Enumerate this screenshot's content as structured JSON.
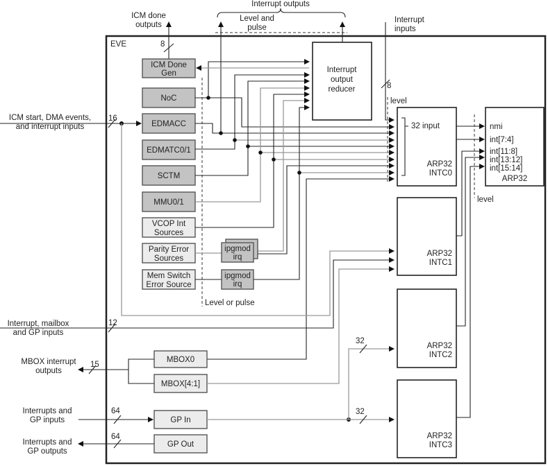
{
  "frame_label": "EVE",
  "blocks": {
    "icm_done_gen": [
      "ICM Done",
      "Gen"
    ],
    "noc": "NoC",
    "edmacc": "EDMACC",
    "edmatc": "EDMATC0/1",
    "sctm": "SCTM",
    "mmu": "MMU0/1",
    "vcop": [
      "VCOP Int",
      "Sources"
    ],
    "parity": [
      "Parity Error",
      "Sources"
    ],
    "memswitch": [
      "Mem Switch",
      "Error Source"
    ],
    "ipgmod1": [
      "ipgmod",
      "irq"
    ],
    "ipgmod2": [
      "ipgmod",
      "irq"
    ],
    "reducer": [
      "Interrupt",
      "output",
      "reducer"
    ],
    "intc0": [
      "ARP32",
      "INTC0"
    ],
    "intc0_input_label": "32 input",
    "intc1": [
      "ARP32",
      "INTC1"
    ],
    "intc2": [
      "ARP32",
      "INTC2"
    ],
    "intc3": [
      "ARP32",
      "INTC3"
    ],
    "arp32": "ARP32",
    "arp32_ports": [
      "nmi",
      "int[7:4]",
      "int[11:8]",
      "int[13:12]",
      "int[15:14]"
    ],
    "mbox0": "MBOX0",
    "mbox41": "MBOX[4:1]",
    "gp_in": "GP In",
    "gp_out": "GP Out"
  },
  "signals": {
    "icm_done_outputs": [
      "ICM done",
      "outputs"
    ],
    "interrupt_outputs": "Interrupt outputs",
    "level_and_pulse": [
      "Level and",
      "pulse"
    ],
    "interrupt_inputs": [
      "Interrupt",
      "inputs"
    ],
    "icm_start": [
      "ICM start, DMA events,",
      "and interrupt inputs"
    ],
    "int_mailbox_gp": [
      "Interrupt, mailbox",
      "and GP inputs"
    ],
    "mbox_outputs": [
      "MBOX interrupt",
      "outputs"
    ],
    "gp_inputs": [
      "Interrupts and",
      "GP inputs"
    ],
    "gp_outputs": [
      "Interrupts and",
      "GP outputs"
    ],
    "level_or_pulse": "Level or pulse",
    "level_top": "level",
    "level_right": "level"
  },
  "bus_widths": {
    "icm_done": "8",
    "interrupt_inputs": "8",
    "icm_start": "16",
    "int_mailbox_gp": "12",
    "mbox_out": "15",
    "intc2_in": "32",
    "intc3_in": "32",
    "gp_in": "64",
    "gp_out": "64"
  }
}
